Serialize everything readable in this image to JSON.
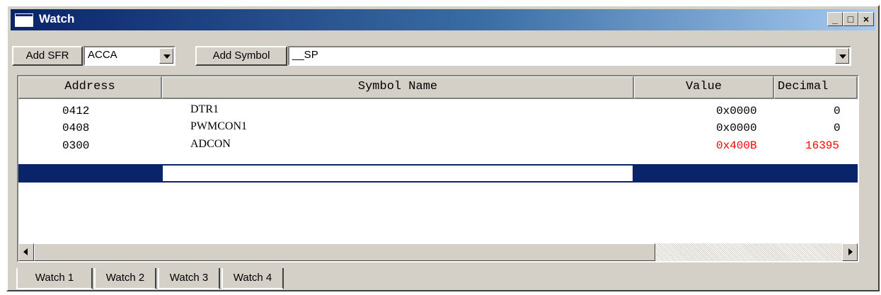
{
  "window": {
    "title": "Watch",
    "controls": {
      "minimize": "_",
      "maximize": "□",
      "close": "×"
    }
  },
  "toolbar": {
    "add_sfr_label": "Add SFR",
    "sfr_select_value": "ACCA",
    "add_symbol_label": "Add Symbol",
    "symbol_select_value": "__SP"
  },
  "table": {
    "columns": [
      "Address",
      "Symbol Name",
      "Value",
      "Decimal"
    ],
    "rows": [
      {
        "address": "0412",
        "symbol": "DTR1",
        "value": "0x0000",
        "decimal": "0",
        "changed": false
      },
      {
        "address": "0408",
        "symbol": "PWMCON1",
        "value": "0x0000",
        "decimal": "0",
        "changed": false
      },
      {
        "address": "0300",
        "symbol": "ADCON",
        "value": "0x400B",
        "decimal": "16395",
        "changed": true
      }
    ]
  },
  "tabs": [
    "Watch 1",
    "Watch 2",
    "Watch 3",
    "Watch 4"
  ],
  "colors": {
    "title_gradient_start": "#0a246a",
    "title_gradient_end": "#a6caf0",
    "selection": "#0a246a",
    "changed_value": "#ff0000",
    "chrome": "#d4d0c8"
  },
  "icons": [
    "window-icon",
    "minimize-icon",
    "maximize-icon",
    "close-icon",
    "dropdown-arrow-icon",
    "scroll-left-icon",
    "scroll-right-icon"
  ]
}
